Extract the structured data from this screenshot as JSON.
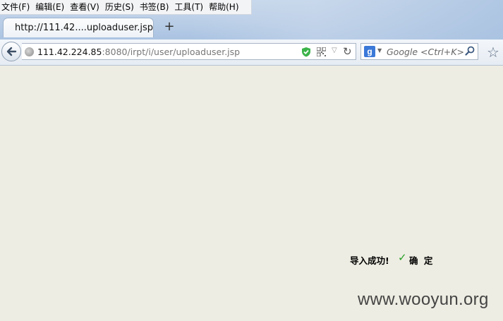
{
  "menu": {
    "items": [
      "文件(F)",
      "编辑(E)",
      "查看(V)",
      "历史(S)",
      "书签(B)",
      "工具(T)",
      "帮助(H)"
    ]
  },
  "tab": {
    "title": "http://111.42....uploaduser.jsp",
    "new_tab_label": "+"
  },
  "address": {
    "host": "111.42.224.85",
    "path": ":8080/irpt/i/user/uploaduser.jsp"
  },
  "search": {
    "engine_icon": "g-icon",
    "placeholder": "Google <Ctrl+K>"
  },
  "content": {
    "message": "导入成功!",
    "confirm_label": "确 定",
    "watermark": "www.wooyun.org"
  },
  "colors": {
    "page_bg": "#eeede3",
    "check": "#27a027",
    "shield": "#3bb34a",
    "google": "#3b79d8"
  }
}
